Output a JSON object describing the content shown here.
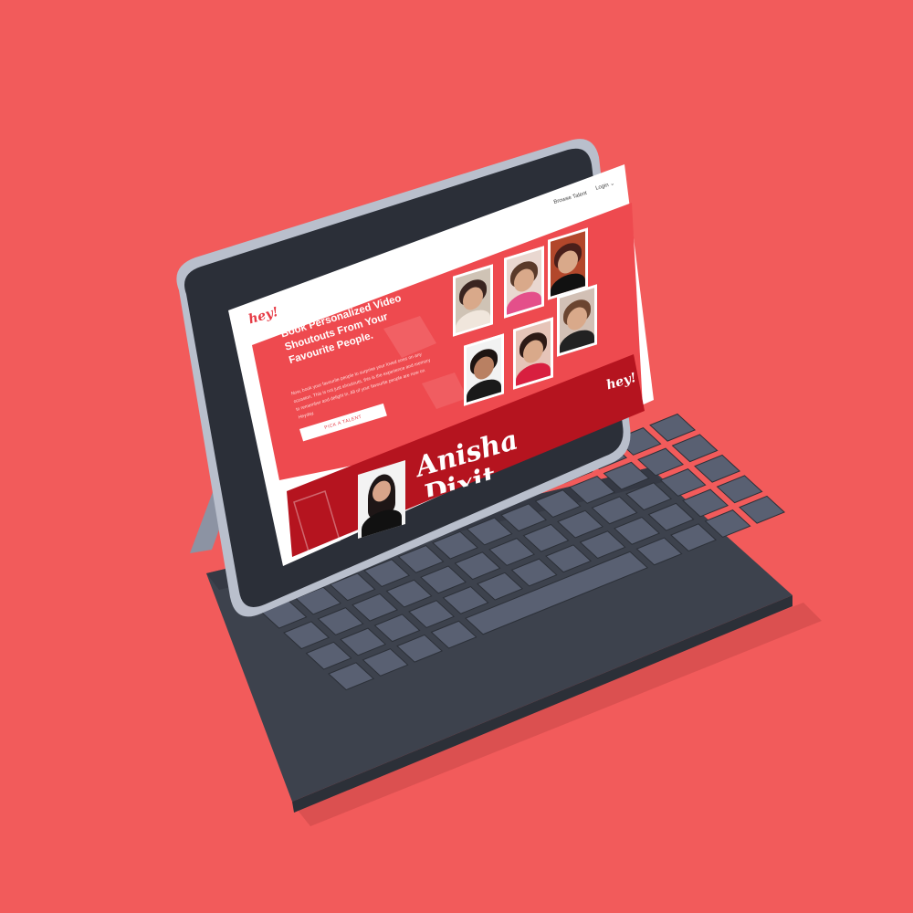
{
  "colors": {
    "background": "#f25b5b",
    "brand_red": "#e63a44",
    "banner_red": "#b5141f",
    "keyboard": "#3d424d",
    "key": "#596072"
  },
  "site": {
    "logo": "hey!",
    "nav": {
      "browse": "Browse Talent",
      "login": "Login"
    },
    "hero": {
      "title": "Book Personalized Video Shoutouts From Your Favourite People.",
      "description": "Now, book your favourite people to surprise your loved ones on any occasion. This is not just shoutouts, this is the experience and memory to remember and delight in. All of your favourite people are now on Heyday.",
      "cta": "PICK A TALENT"
    },
    "banner": {
      "logo": "hey!",
      "name_line1": "Anisha",
      "name_line2": "Dixit"
    }
  },
  "icons": {
    "login_chevron": "chevron-down-icon"
  }
}
